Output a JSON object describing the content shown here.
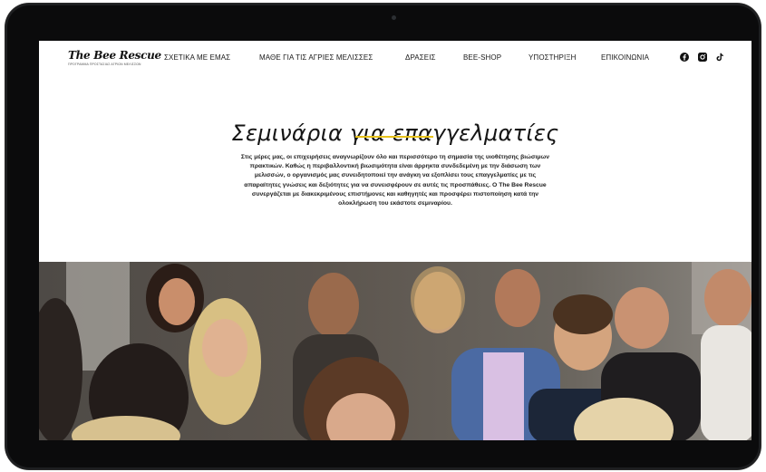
{
  "logo": {
    "name": "The Bee Rescue",
    "tagline": "ΠΡΟΓΡΑΜΜΑ ΠΡΟΣΤΑΣΙΑΣ ΑΓΡΙΩΝ ΜΕΛΙΣΣΩΝ"
  },
  "nav": {
    "items": [
      {
        "label": "ΣΧΕΤΙΚΑ ΜΕ ΕΜΑΣ"
      },
      {
        "label": "ΜΑΘΕ ΓΙΑ ΤΙΣ ΑΓΡΙΕΣ ΜΕΛΙΣΣΕΣ"
      },
      {
        "label": "ΔΡΑΣΕΙΣ"
      },
      {
        "label": "BEE-SHOP"
      },
      {
        "label": "ΥΠΟΣΤΗΡΙΞΗ"
      },
      {
        "label": "ΕΠΙΚΟΙΝΩΝΙΑ"
      }
    ],
    "social_icons": [
      "facebook-icon",
      "instagram-icon",
      "tiktok-icon"
    ]
  },
  "hero": {
    "title": "Σεμινάρια για επαγγελματίες",
    "paragraph": "Στις μέρες μας, οι επιχειρήσεις αναγνωρίζουν όλο και περισσότερο τη σημασία της υιοθέτησης βιώσιμων πρακτικών. Καθώς η περιβαλλοντική βιωσιμότητα είναι άρρηκτα συνδεδεμένη με την διάσωση των μελισσών, ο οργανισμός μας συνειδητοποιεί την ανάγκη να εξοπλίσει τους επαγγελματίες με τις απαραίτητες γνώσεις και δεξιότητες για να συνεισφέρουν σε αυτές τις προσπάθειες. Ο The Bee Rescue συνεργάζεται με διακεκριμένους επιστήμονες και καθηγητές και προσφέρει πιστοποίηση κατά την ολοκλήρωση του εκάστοτε σεμιναρίου."
  },
  "colors": {
    "accent": "#e7c21a",
    "device": "#0b0b0c",
    "text": "#1a1a1a"
  }
}
